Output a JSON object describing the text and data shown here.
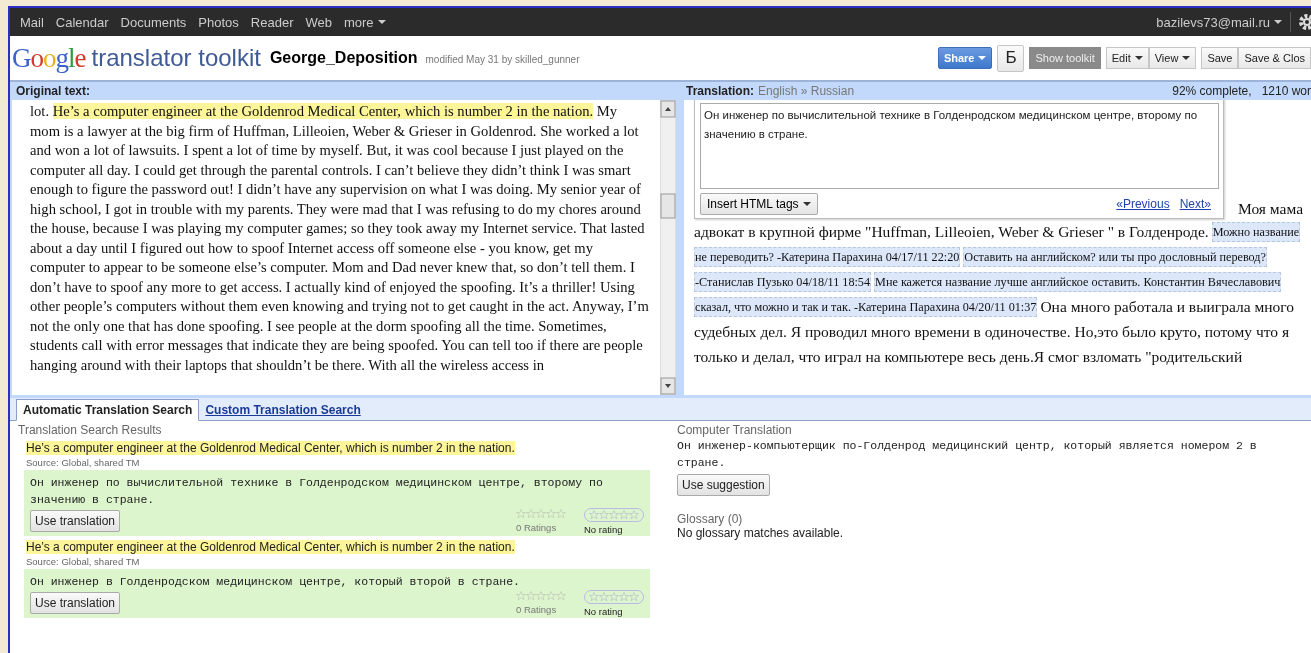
{
  "top_nav": {
    "items": [
      "Mail",
      "Calendar",
      "Documents",
      "Photos",
      "Reader",
      "Web",
      "more"
    ],
    "account": "bazilevs73@mail.ru"
  },
  "header": {
    "logo": "Google",
    "product": "translator toolkit",
    "document_title": "George_Deposition",
    "modified": "modified May 31 by skilled_gunner",
    "buttons": [
      {
        "kind": "share",
        "label": "Share"
      },
      {
        "kind": "square",
        "label": "Б"
      },
      {
        "kind": "dark",
        "label": "Show toolkit"
      },
      {
        "kind": "menu",
        "label": "Edit"
      },
      {
        "kind": "menu",
        "label": "View"
      },
      {
        "kind": "plain",
        "label": "Save"
      },
      {
        "kind": "plain",
        "label": "Save & Clos"
      }
    ]
  },
  "original": {
    "heading": "Original text:",
    "segments": [
      {
        "text": "lot. ",
        "highlighted": false
      },
      {
        "text": "He’s a computer engineer at the Goldenrod Medical Center, which is number 2 in the nation.",
        "highlighted": true
      },
      {
        "text": " My mom is a lawyer at the big firm of Huffman, Lilleoien, Weber & Grieser in Goldenrod. She worked a lot and won a lot of lawsuits. I spent a lot of time by myself. But, it was cool because I just played on the computer all day. I could get through the parental controls. I can’t believe they didn’t think I was smart enough to figure the password out! I didn’t have any supervision on what I was doing. My senior year of high school, I got in trouble with my parents. They were mad that I was refusing to do my chores around the house, because I was playing my computer games; so they took away my Internet service. That lasted about a day until I figured out how to spoof Internet access off someone else - you know, get my computer to appear to be someone else’s computer. Mom and Dad never knew that, so don’t tell them. I don’t have to spoof any more to get access. I actually kind of enjoyed the spoofing. It’s a thriller! Using other people’s computers without them even knowing and trying not to get caught in the act. Anyway, I’m not the only one that has done spoofing. I see people at the dorm spoofing all the time. Sometimes, students call with error messages that indicate they are being spoofed. You can tell too if there are people hanging around with their laptops that shouldn’t be there. With all the wireless access in",
        "highlighted": false
      }
    ]
  },
  "translation": {
    "heading": "Translation:",
    "languages": "English » Russian",
    "progress": "92% complete,",
    "words": "1210 wor",
    "editor": {
      "value": "Он инженер по вычислительной технике в Голденродском  медицинском центре, второму по значению в стране.",
      "insert_button": "Insert HTML tags",
      "previous": "«Previous",
      "next": "Next»"
    },
    "lines": [
      [
        {
          "kind": "text",
          "text": "Моя мама"
        }
      ],
      [
        {
          "kind": "text",
          "text": "адвокат в крупной фирме \"Huffman, Lilleoien, Weber & Grieser \" в Голденроде."
        },
        {
          "kind": "comment",
          "text": "Можно название"
        }
      ],
      [
        {
          "kind": "comment",
          "text": "не переводить? -Катерина Парахина 04/17/11 22:20"
        },
        {
          "kind": "comment",
          "text": "Оставить на английском? или ты про дословный перевод?"
        }
      ],
      [
        {
          "kind": "comment",
          "text": "-Станислав Пузько 04/18/11 18:54"
        },
        {
          "kind": "comment",
          "text": "Мне кажется название лучше английское оставить. Константин Вячеславович"
        }
      ],
      [
        {
          "kind": "comment",
          "text": "сказал, что можно и так и так. -Катерина Парахина 04/20/11 01:37"
        },
        {
          "kind": "text",
          "text": "Она много работала и выиграла много"
        }
      ],
      [
        {
          "kind": "text",
          "text": "судебных дел. Я проводил много времени в одиночестве. Но,это было круто, потому что я"
        }
      ],
      [
        {
          "kind": "text",
          "text": "только и делал, что играл на компьютере весь день.Я смог взломать \"родительский"
        }
      ]
    ]
  },
  "bottom_tabs": [
    {
      "label": "Automatic Translation Search",
      "selected": true
    },
    {
      "label": "Custom Translation Search",
      "selected": false
    }
  ],
  "search_results": {
    "heading": "Translation Search Results",
    "results": [
      {
        "source": "He’s a computer engineer at the Goldenrod Medical Center, which is number 2 in the nation.",
        "origin": "Source: Global, shared TM",
        "translation": "Он инженер по вычислительной технике в Голденродском медицинском центре, второму по значению в стране.",
        "button": "Use translation",
        "rating": {
          "stars": 0,
          "label": "0 Ratings"
        },
        "my_rating": {
          "stars": 0,
          "label": "No rating"
        }
      },
      {
        "source": "He’s a computer engineer at the Goldenrod Medical Center, which is number 2 in the nation.",
        "origin": "Source: Global, shared TM",
        "translation": "Он инженер в Голденродском медицинском центре, который второй в стране.",
        "button": "Use translation",
        "rating": {
          "stars": 0,
          "label": "0 Ratings"
        },
        "my_rating": {
          "stars": 0,
          "label": "No rating"
        }
      }
    ]
  },
  "computer_translation": {
    "heading": "Computer Translation",
    "text": "Он инженер-компьютерщик по-Голденрод медицинский центр, который является номером 2 в стране.",
    "button": "Use suggestion"
  },
  "glossary": {
    "heading": "Glossary (0)",
    "message": "No glossary matches available."
  }
}
